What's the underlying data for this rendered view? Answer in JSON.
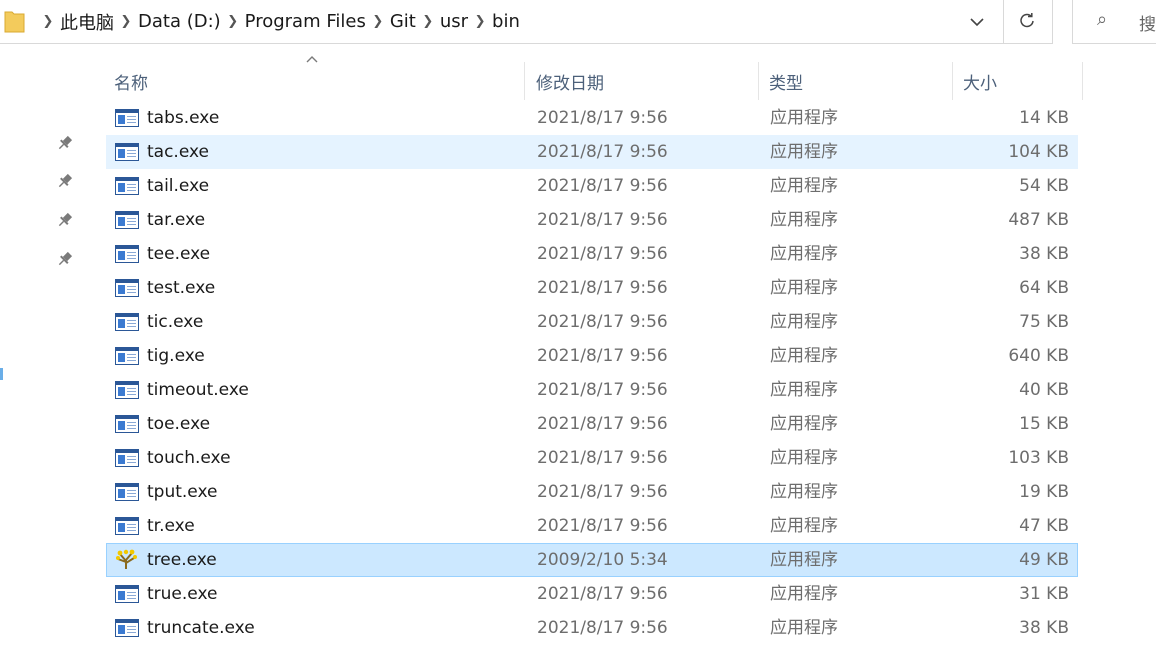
{
  "address": {
    "crumbs": [
      "此电脑",
      "Data (D:)",
      "Program Files",
      "Git",
      "usr",
      "bin"
    ],
    "search_placeholder": "搜"
  },
  "columns": {
    "name": "名称",
    "date": "修改日期",
    "type": "类型",
    "size": "大小"
  },
  "files": [
    {
      "name": "tabs.exe",
      "date": "2021/8/17 9:56",
      "type": "应用程序",
      "size": "14 KB",
      "icon": "app-window-icon",
      "state": ""
    },
    {
      "name": "tac.exe",
      "date": "2021/8/17 9:56",
      "type": "应用程序",
      "size": "104 KB",
      "icon": "app-window-icon",
      "state": "hover"
    },
    {
      "name": "tail.exe",
      "date": "2021/8/17 9:56",
      "type": "应用程序",
      "size": "54 KB",
      "icon": "app-window-icon",
      "state": ""
    },
    {
      "name": "tar.exe",
      "date": "2021/8/17 9:56",
      "type": "应用程序",
      "size": "487 KB",
      "icon": "app-window-icon",
      "state": ""
    },
    {
      "name": "tee.exe",
      "date": "2021/8/17 9:56",
      "type": "应用程序",
      "size": "38 KB",
      "icon": "app-window-icon",
      "state": ""
    },
    {
      "name": "test.exe",
      "date": "2021/8/17 9:56",
      "type": "应用程序",
      "size": "64 KB",
      "icon": "app-window-icon",
      "state": ""
    },
    {
      "name": "tic.exe",
      "date": "2021/8/17 9:56",
      "type": "应用程序",
      "size": "75 KB",
      "icon": "app-window-icon",
      "state": ""
    },
    {
      "name": "tig.exe",
      "date": "2021/8/17 9:56",
      "type": "应用程序",
      "size": "640 KB",
      "icon": "app-window-icon",
      "state": ""
    },
    {
      "name": "timeout.exe",
      "date": "2021/8/17 9:56",
      "type": "应用程序",
      "size": "40 KB",
      "icon": "app-window-icon",
      "state": ""
    },
    {
      "name": "toe.exe",
      "date": "2021/8/17 9:56",
      "type": "应用程序",
      "size": "15 KB",
      "icon": "app-window-icon",
      "state": ""
    },
    {
      "name": "touch.exe",
      "date": "2021/8/17 9:56",
      "type": "应用程序",
      "size": "103 KB",
      "icon": "app-window-icon",
      "state": ""
    },
    {
      "name": "tput.exe",
      "date": "2021/8/17 9:56",
      "type": "应用程序",
      "size": "19 KB",
      "icon": "app-window-icon",
      "state": ""
    },
    {
      "name": "tr.exe",
      "date": "2021/8/17 9:56",
      "type": "应用程序",
      "size": "47 KB",
      "icon": "app-window-icon",
      "state": ""
    },
    {
      "name": "tree.exe",
      "date": "2009/2/10 5:34",
      "type": "应用程序",
      "size": "49 KB",
      "icon": "tree-icon",
      "state": "selected"
    },
    {
      "name": "true.exe",
      "date": "2021/8/17 9:56",
      "type": "应用程序",
      "size": "31 KB",
      "icon": "app-window-icon",
      "state": ""
    },
    {
      "name": "truncate.exe",
      "date": "2021/8/17 9:56",
      "type": "应用程序",
      "size": "38 KB",
      "icon": "app-window-icon",
      "state": ""
    }
  ]
}
